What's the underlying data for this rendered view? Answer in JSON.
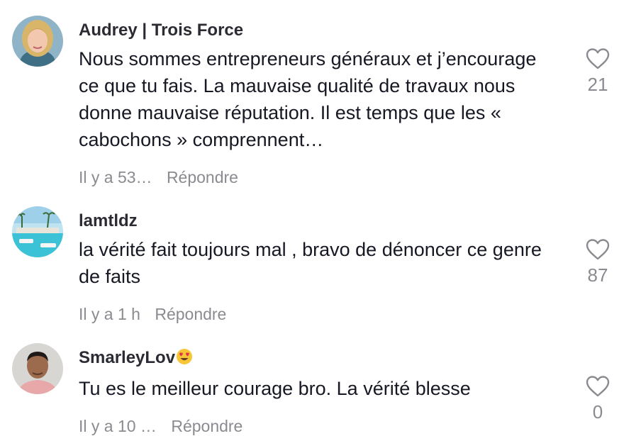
{
  "comments": [
    {
      "username": "Audrey | Trois Force",
      "text": "Nous sommes entrepreneurs généraux et j’encourage ce que tu fais. La mauvaise qualité de travaux nous donne mauvaise réputation. Il est temps que les « cabochons » comprennent…",
      "time": "Il y a 53…",
      "reply_label": "Répondre",
      "likes": "21",
      "avatar": "woman-blonde-portrait"
    },
    {
      "username": "lamtldz",
      "text": "la vérité fait toujours mal , bravo de dénoncer ce genre de faits",
      "time": "Il y a 1 h",
      "reply_label": "Répondre",
      "likes": "87",
      "avatar": "beach-resort-landscape"
    },
    {
      "username": "SmarleyLov",
      "username_emoji": "heart-eyes-emoji",
      "text": "Tu es le meilleur courage bro. La vérité blesse",
      "time": "Il y a 10 …",
      "reply_label": "Répondre",
      "likes": "0",
      "avatar": "man-portrait"
    }
  ],
  "icons": {
    "like": "heart-outline-icon"
  },
  "colors": {
    "text": "#161823",
    "secondary": "#8a8b91",
    "username": "#2b2b33"
  }
}
